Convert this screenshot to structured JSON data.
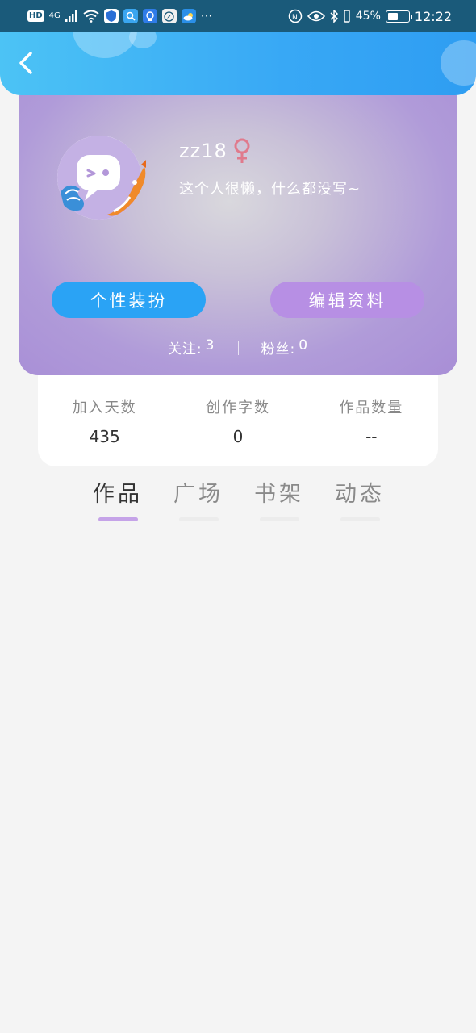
{
  "status_bar": {
    "hd": "HD",
    "network": "4G",
    "battery": "45%",
    "battery_level": 0.45,
    "time": "12:22",
    "more": "···"
  },
  "profile": {
    "username": "zz18",
    "bio": "这个人很懒，什么都没写~",
    "buttons": {
      "dress_up": "个性装扮",
      "edit_profile": "编辑资料"
    },
    "following_label": "关注:",
    "following_count": "3",
    "followers_label": "粉丝:",
    "followers_count": "0"
  },
  "stats": [
    {
      "label": "加入天数",
      "value": "435"
    },
    {
      "label": "创作字数",
      "value": "0"
    },
    {
      "label": "作品数量",
      "value": "--"
    }
  ],
  "tabs": [
    {
      "label": "作品",
      "active": true
    },
    {
      "label": "广场",
      "active": false
    },
    {
      "label": "书架",
      "active": false
    },
    {
      "label": "动态",
      "active": false
    }
  ],
  "colors": {
    "header_start": "#4cc3f5",
    "header_end": "#2e9df2",
    "dress_button": "#2aa3f5",
    "edit_button": "#b78fe4",
    "card_purple": "#a88ed6",
    "tab_underline_active": "#c5a3e8",
    "gender_icon": "#e07a8c"
  }
}
